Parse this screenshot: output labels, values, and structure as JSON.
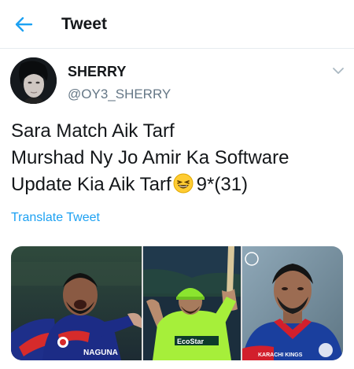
{
  "header": {
    "title": "Tweet",
    "back_icon": "arrow-left-icon"
  },
  "tweet": {
    "display_name": "SHERRY",
    "handle": "@OY3_SHERRY",
    "text_lines": [
      "Sara Match Aik Tarf",
      "Murshad Ny Jo Amir Ka Software",
      "Update Kia Aik Tarf",
      "9*(31)"
    ],
    "emoji": "grinning-squinting-face",
    "translate_label": "Translate Tweet"
  },
  "media": {
    "photos": [
      {
        "subject": "cricketer celebrating",
        "shirt_text": "NAGUNA"
      },
      {
        "subject": "batsman raising bat",
        "shirt_text": "EcoStar"
      },
      {
        "subject": "cricketer portrait",
        "shirt_text": "KARACHI KINGS"
      }
    ]
  },
  "colors": {
    "accent": "#1da1f2",
    "text": "#14171a",
    "secondary": "#657786"
  }
}
